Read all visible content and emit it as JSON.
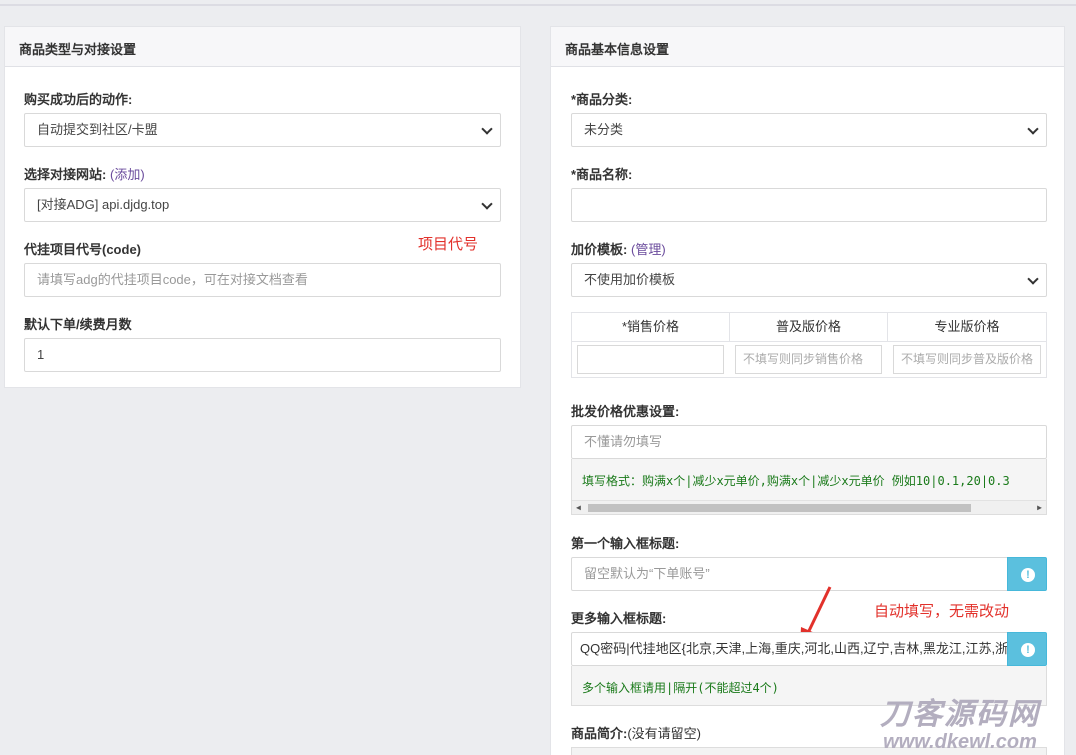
{
  "left_panel": {
    "title": "商品类型与对接设置",
    "action_label": "购买成功后的动作:",
    "action_value": "自动提交到社区/卡盟",
    "site_label": "选择对接网站:",
    "site_add_open": "(",
    "site_add_link": "添加",
    "site_add_close": ")",
    "site_value": "[对接ADG] api.djdg.top",
    "code_label": "代挂项目代号(code)",
    "code_placeholder": "请填写adg的代挂项目code，可在对接文档查看",
    "months_label": "默认下单/续费月数",
    "months_value": "1"
  },
  "right_panel": {
    "title": "商品基本信息设置",
    "category_label": "*商品分类:",
    "category_value": "未分类",
    "name_label": "*商品名称:",
    "name_value": "",
    "markup_label": "加价模板:",
    "markup_manage_open": "(",
    "markup_manage_link": "管理",
    "markup_manage_close": ")",
    "markup_value": "不使用加价模板",
    "price_table": {
      "headers": [
        "*销售价格",
        "普及版价格",
        "专业版价格"
      ],
      "placeholders": [
        "",
        "不填写则同步销售价格",
        "不填写则同步普及版价格"
      ]
    },
    "wholesale_label": "批发价格优惠设置:",
    "wholesale_placeholder": "不懂请勿填写",
    "wholesale_help": "填写格式：购满x个|减少x元单价,购满x个|减少x元单价  例如10|0.1,20|0.3",
    "first_input_label": "第一个输入框标题:",
    "first_input_placeholder": "留空默认为“下单账号”",
    "more_input_label": "更多输入框标题:",
    "more_input_value": "QQ密码|代挂地区{北京,天津,上海,重庆,河北,山西,辽宁,吉林,黑龙江,江苏,浙江}",
    "more_input_help": "多个输入框请用|隔开(不能超过4个)",
    "intro_label": "商品简介:",
    "intro_note": "(没有请留空)"
  },
  "annotations": {
    "project_code": "项目代号",
    "auto_fill": "自动填写，无需改动"
  },
  "watermark": {
    "name": "刀客源码网",
    "url": "www.dkewl.com"
  },
  "colors": {
    "annotation": "#e2312b",
    "link": "#6a4b9c",
    "info_button": "#5bc0de",
    "help_text": "#1a7a1a"
  },
  "icons": {
    "select_caret": "chevron-down-icon",
    "info_button": "exclamation-circle-icon",
    "annotation_arrow": "red-arrow-icon"
  }
}
